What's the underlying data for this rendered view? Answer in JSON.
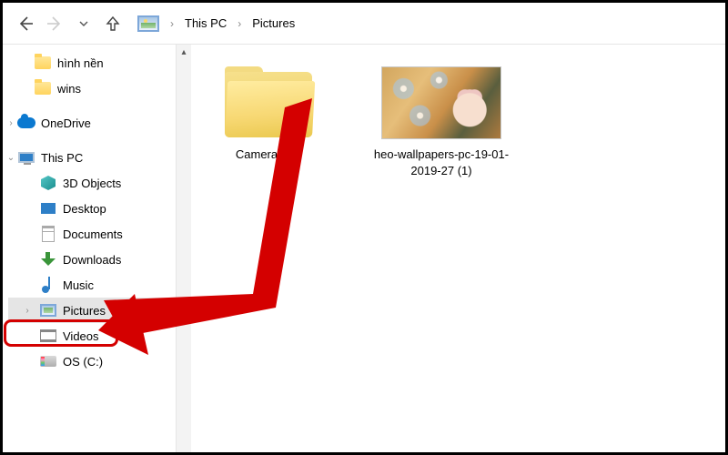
{
  "nav": {
    "breadcrumb": [
      "This PC",
      "Pictures"
    ]
  },
  "tree": {
    "orphans": [
      {
        "label": "hình nền"
      },
      {
        "label": "wins"
      }
    ],
    "onedrive": {
      "label": "OneDrive"
    },
    "thispc": {
      "label": "This PC",
      "children": [
        {
          "label": "3D Objects"
        },
        {
          "label": "Desktop"
        },
        {
          "label": "Documents"
        },
        {
          "label": "Downloads"
        },
        {
          "label": "Music"
        },
        {
          "label": "Pictures",
          "selected": true
        },
        {
          "label": "Videos"
        },
        {
          "label": "OS (C:)"
        }
      ]
    }
  },
  "content": {
    "items": [
      {
        "type": "folder",
        "label": "Camera Roll"
      },
      {
        "type": "image",
        "label": "heo-wallpapers-pc-19-01-2019-27 (1)"
      }
    ]
  },
  "annotation": {
    "highlight_target": "Pictures",
    "arrow_from": "Camera Roll",
    "arrow_color": "#d40000"
  }
}
